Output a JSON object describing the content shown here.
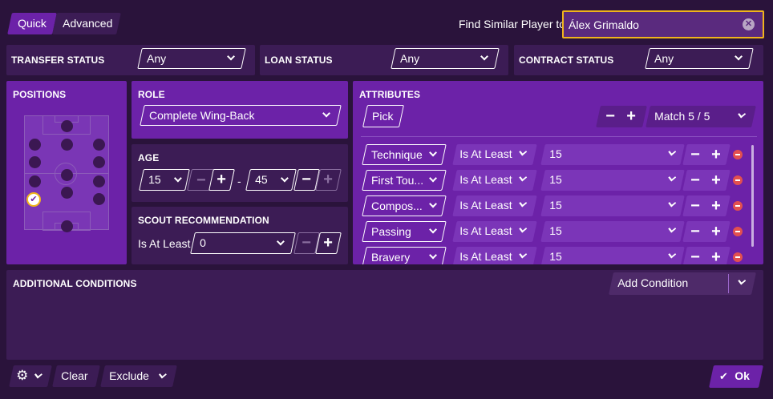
{
  "top": {
    "tab_quick": "Quick",
    "tab_advanced": "Advanced",
    "find_similar_label": "Find Similar Player to",
    "find_similar_value": "Álex Grimaldo"
  },
  "filters": {
    "transfer_status_label": "TRANSFER STATUS",
    "transfer_status_value": "Any",
    "loan_status_label": "LOAN STATUS",
    "loan_status_value": "Any",
    "contract_status_label": "CONTRACT STATUS",
    "contract_status_value": "Any"
  },
  "positions": {
    "label": "POSITIONS"
  },
  "role": {
    "label": "ROLE",
    "value": "Complete Wing-Back"
  },
  "age": {
    "label": "AGE",
    "min": "15",
    "max": "45",
    "separator": "-"
  },
  "scout": {
    "label": "SCOUT RECOMMENDATION",
    "operator": "Is At Least",
    "value": "0"
  },
  "attributes": {
    "label": "ATTRIBUTES",
    "pick_label": "Pick",
    "match_label": "Match 5 / 5",
    "rows": [
      {
        "name": "Technique",
        "op": "Is At Least",
        "value": "15"
      },
      {
        "name": "First Tou...",
        "op": "Is At Least",
        "value": "15"
      },
      {
        "name": "Compos...",
        "op": "Is At Least",
        "value": "15"
      },
      {
        "name": "Passing",
        "op": "Is At Least",
        "value": "15"
      },
      {
        "name": "Bravery",
        "op": "Is At Least",
        "value": "15"
      }
    ]
  },
  "additional": {
    "label": "ADDITIONAL CONDITIONS",
    "add_label": "Add Condition"
  },
  "footer": {
    "clear_label": "Clear",
    "exclude_label": "Exclude",
    "ok_label": "Ok"
  },
  "icons": {
    "minus": "−",
    "plus": "+",
    "check": "✔",
    "gear": "⚙",
    "clear": "✕"
  },
  "colors": {
    "accent_purple": "#6c22a8",
    "panel_dark": "#3c1c55",
    "background": "#2a133b",
    "highlight": "#f0b41c",
    "remove_red": "#e2504f"
  }
}
